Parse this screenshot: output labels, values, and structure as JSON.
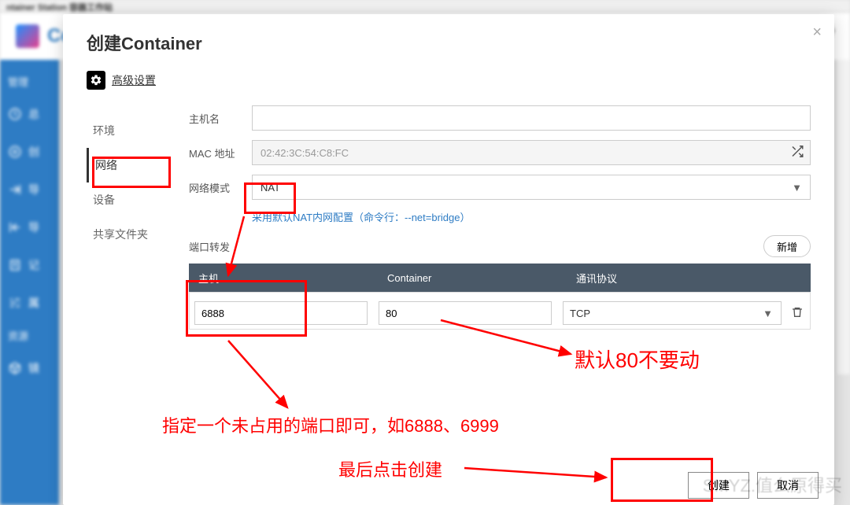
{
  "backdrop": {
    "window_title": "ntainer Station 容器工作站",
    "app_title": "Co",
    "sidebar_category1": "管理",
    "sidebar_items1": [
      "总",
      "创",
      "导",
      "导",
      "记",
      "属"
    ],
    "sidebar_category2": "资源",
    "sidebar_items2": [
      "镜"
    ]
  },
  "modal": {
    "title": "创建Container",
    "advanced_link": "高级设置",
    "tabs": {
      "env": "环境",
      "network": "网络",
      "device": "设备",
      "shared": "共享文件夹"
    },
    "form": {
      "hostname_label": "主机名",
      "hostname_value": "",
      "mac_label": "MAC 地址",
      "mac_value": "02:42:3C:54:C8:FC",
      "netmode_label": "网络模式",
      "netmode_value": "NAT",
      "netmode_desc": "采用默认NAT内网配置（命令行：--net=bridge）",
      "portfwd_label": "端口转发",
      "add_button": "新增",
      "table": {
        "col_host": "主机",
        "col_container": "Container",
        "col_protocol": "通讯协议",
        "rows": [
          {
            "host": "6888",
            "container": "80",
            "protocol": "TCP"
          }
        ]
      }
    },
    "footer": {
      "create": "创建",
      "cancel": "取消"
    }
  },
  "annotations": {
    "port_hint": "指定一个未占用的端口即可，如6888、6999",
    "container_hint": "默认80不要动",
    "create_hint": "最后点击创建"
  },
  "watermark": "SMYZ.值么原得买"
}
